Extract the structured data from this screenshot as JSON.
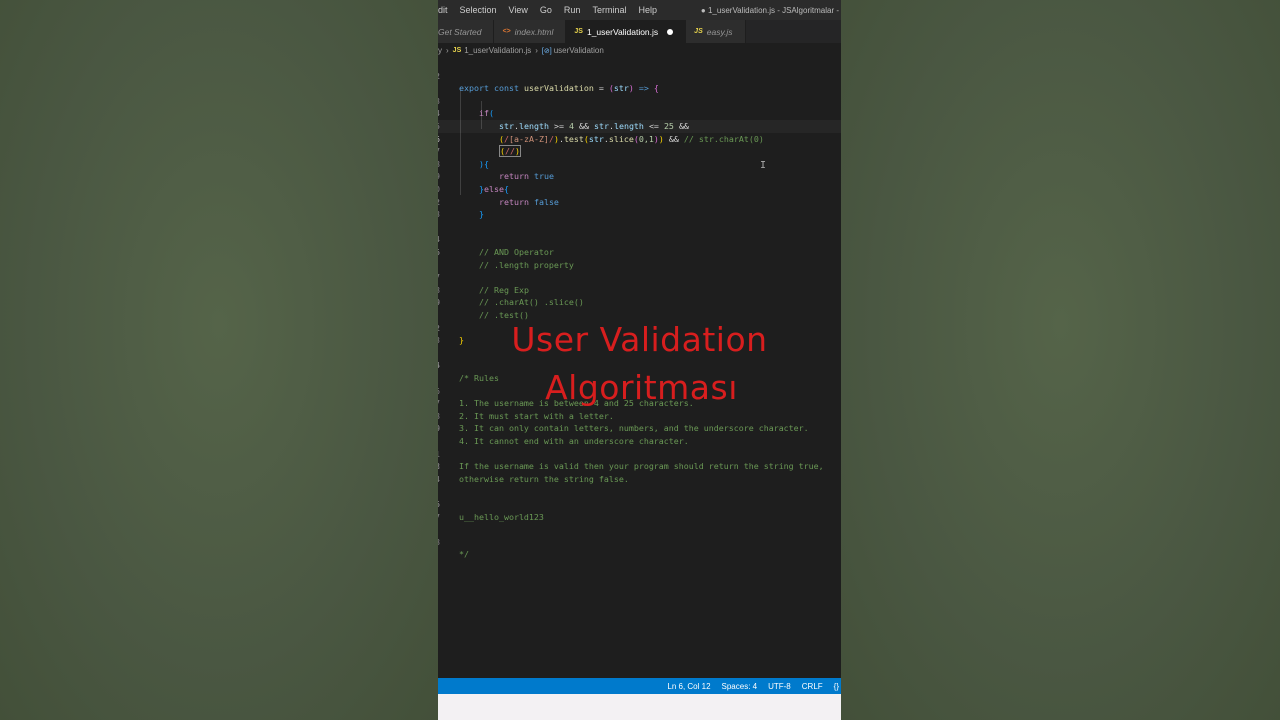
{
  "menubar": {
    "items": [
      "dit",
      "Selection",
      "View",
      "Go",
      "Run",
      "Terminal",
      "Help"
    ],
    "window_title": "● 1_userValidation.js - JSAlgoritmalar -"
  },
  "tabs": [
    {
      "label": "Get Started",
      "icon": ""
    },
    {
      "label": "index.html",
      "icon": "<>"
    },
    {
      "label": "1_userValidation.js",
      "icon": "JS",
      "active": true,
      "modified": true
    },
    {
      "label": "easy.js",
      "icon": "JS"
    }
  ],
  "breadcrumb": {
    "folder": "y",
    "file": "1_userValidation.js",
    "symbol": "userValidation",
    "file_icon": "JS",
    "symbol_icon": "[⊘]"
  },
  "line_numbers": [
    "1",
    "2",
    "3",
    "4",
    "5",
    "6",
    "7",
    "8",
    "9",
    "0",
    "1",
    "2",
    "3",
    "4",
    "5",
    "6",
    "7",
    "8",
    "9",
    "0",
    "1",
    "2",
    "3",
    "4",
    "5",
    "6",
    "7",
    "8",
    "9",
    "0",
    "1",
    "2",
    "3",
    "4",
    "5",
    "6",
    "7",
    "8"
  ],
  "code": {
    "l1": [
      "export",
      "const",
      "userValidation",
      "=",
      "(",
      "str",
      ")",
      "=>",
      "{"
    ],
    "l3": [
      "if",
      "("
    ],
    "l4": [
      "str",
      ".",
      "length",
      ">=",
      "4",
      "&&",
      "str",
      ".",
      "length",
      "<=",
      "25",
      "&&"
    ],
    "l5": [
      "(",
      "/",
      "[a-zA-Z]",
      "/",
      ")",
      ".",
      "test",
      "(",
      "str",
      ".",
      "slice",
      "(",
      "0,1",
      ")",
      ")",
      "&&",
      "// str.charAt(0)"
    ],
    "l6": [
      "(",
      "/",
      "/",
      ")"
    ],
    "l7": [
      ")",
      "{"
    ],
    "l8": [
      "return",
      "true"
    ],
    "l9": [
      "}",
      "else",
      "{"
    ],
    "l10": [
      "return",
      "false"
    ],
    "l11": "}",
    "l14": "// AND Operator",
    "l15": "// .length property",
    "l17": "// Reg Exp",
    "l18": "// .charAt() .slice()",
    "l19": "// .test()",
    "l21": "}",
    "l24": "/* Rules",
    "l26": "1. The username is between 4 and 25 characters.",
    "l27": "2. It must start with a letter.",
    "l28": "3. It can only contain letters, numbers, and the underscore character.",
    "l29": "4. It cannot end with an underscore character.",
    "l31": "If the username is valid then your program should return the string true,",
    "l32": "otherwise return the string false.",
    "l35": "u__hello_world123",
    "l38": "*/"
  },
  "overlay": {
    "line1": "User Validation",
    "line2": "Algoritması"
  },
  "statusbar": {
    "position": "Ln 6, Col 12",
    "spaces": "Spaces: 4",
    "encoding": "UTF-8",
    "eol": "CRLF",
    "lang": "{}"
  },
  "colors": {
    "accent": "#007acc",
    "overlay_text": "#d81e1e",
    "editor_bg": "#1e1e1e"
  }
}
